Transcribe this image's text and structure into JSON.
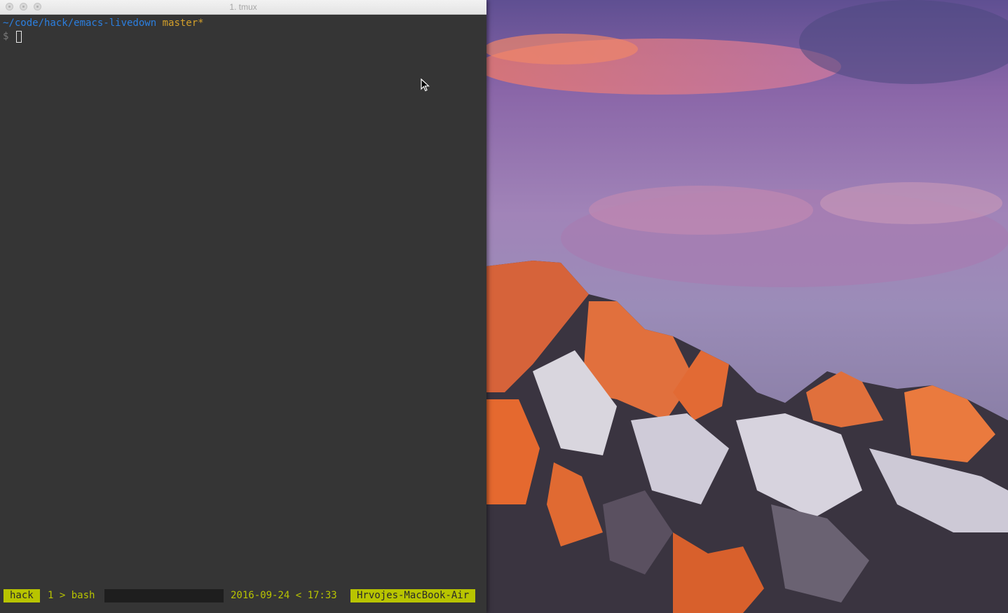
{
  "window": {
    "title": "1. tmux",
    "controls": {
      "close_icon": "close-icon",
      "minimize_icon": "minimize-icon",
      "zoom_icon": "zoom-icon"
    }
  },
  "terminal": {
    "cwd": "~/code/hack/emacs-livedown",
    "branch": "master*",
    "prompt_symbol": "$",
    "colors": {
      "background": "#353535",
      "cwd": "#2b7fe0",
      "branch": "#d4a02a",
      "status_accent": "#b8c400"
    }
  },
  "status_bar": {
    "session": "hack",
    "window": "1 > bash",
    "datetime": "2016-09-24 < 17:33",
    "host": "Hrvojes-MacBook-Air"
  },
  "desktop": {
    "wallpaper": "mountain-sunset-wallpaper",
    "pointer_icon": "mouse-pointer-icon"
  }
}
